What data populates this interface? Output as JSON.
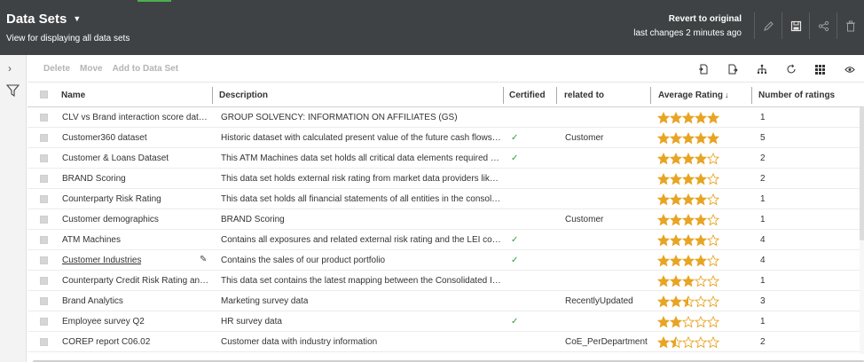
{
  "header": {
    "title": "Data Sets",
    "subtitle": "View for displaying all data sets",
    "revert_label": "Revert to original",
    "last_changes": "last changes 2 minutes ago"
  },
  "toolbar": {
    "delete_label": "Delete",
    "move_label": "Move",
    "add_label": "Add to Data Set"
  },
  "columns": {
    "name": "Name",
    "description": "Description",
    "certified": "Certified",
    "related": "related to",
    "rating": "Average Rating",
    "num_ratings": "Number of ratings"
  },
  "rows": [
    {
      "name": "CLV vs Brand interaction score datas...",
      "description": "GROUP SOLVENCY: INFORMATION ON AFFILIATES (GS)",
      "certified": "",
      "related": "",
      "rating": 5,
      "count": "1"
    },
    {
      "name": "Customer360 dataset",
      "description": "Historic dataset with calculated present value of the future cash flows ...",
      "certified": "✓",
      "related": "Customer",
      "rating": 5,
      "count": "5"
    },
    {
      "name": "Customer & Loans Dataset",
      "description": "This ATM Machines data set holds all critical data elements required fo...",
      "certified": "✓",
      "related": "",
      "rating": 4,
      "count": "2"
    },
    {
      "name": "BRAND Scoring",
      "description": "This data set holds external risk rating from market data providers like ...",
      "certified": "",
      "related": "",
      "rating": 4,
      "count": "2"
    },
    {
      "name": "Counterparty Risk Rating",
      "description": "This data set holds all financial statements of all entities in the consolid...",
      "certified": "",
      "related": "",
      "rating": 4,
      "count": "1"
    },
    {
      "name": "Customer demographics",
      "description": "BRAND Scoring",
      "certified": "",
      "related": "Customer",
      "rating": 4,
      "count": "1"
    },
    {
      "name": "ATM Machines",
      "description": "Contains all exposures and related external risk rating and the LEI code...",
      "certified": "✓",
      "related": "",
      "rating": 4,
      "count": "4"
    },
    {
      "name": "Customer Industries",
      "description": "Contains the sales of our product portfolio",
      "certified": "✓",
      "related": "",
      "rating": 4,
      "count": "4"
    },
    {
      "name": "Counterparty Credit Risk Rating and ...",
      "description": "This data set contains the latest mapping between the Consolidated IF...",
      "certified": "",
      "related": "",
      "rating": 3,
      "count": "1"
    },
    {
      "name": "Brand Analytics",
      "description": "Marketing survey data",
      "certified": "",
      "related": "RecentlyUpdated",
      "rating": 2.5,
      "count": "3"
    },
    {
      "name": "Employee survey Q2",
      "description": "HR survey data",
      "certified": "✓",
      "related": "",
      "rating": 2,
      "count": "1"
    },
    {
      "name": "COREP report C06.02",
      "description": "Customer data with industry information",
      "certified": "",
      "related": "CoE_PerDepartment",
      "rating": 1.5,
      "count": "2"
    }
  ],
  "colors": {
    "header_bg": "#3f4244",
    "star": "#e8a423",
    "check": "#2e9e3a"
  }
}
